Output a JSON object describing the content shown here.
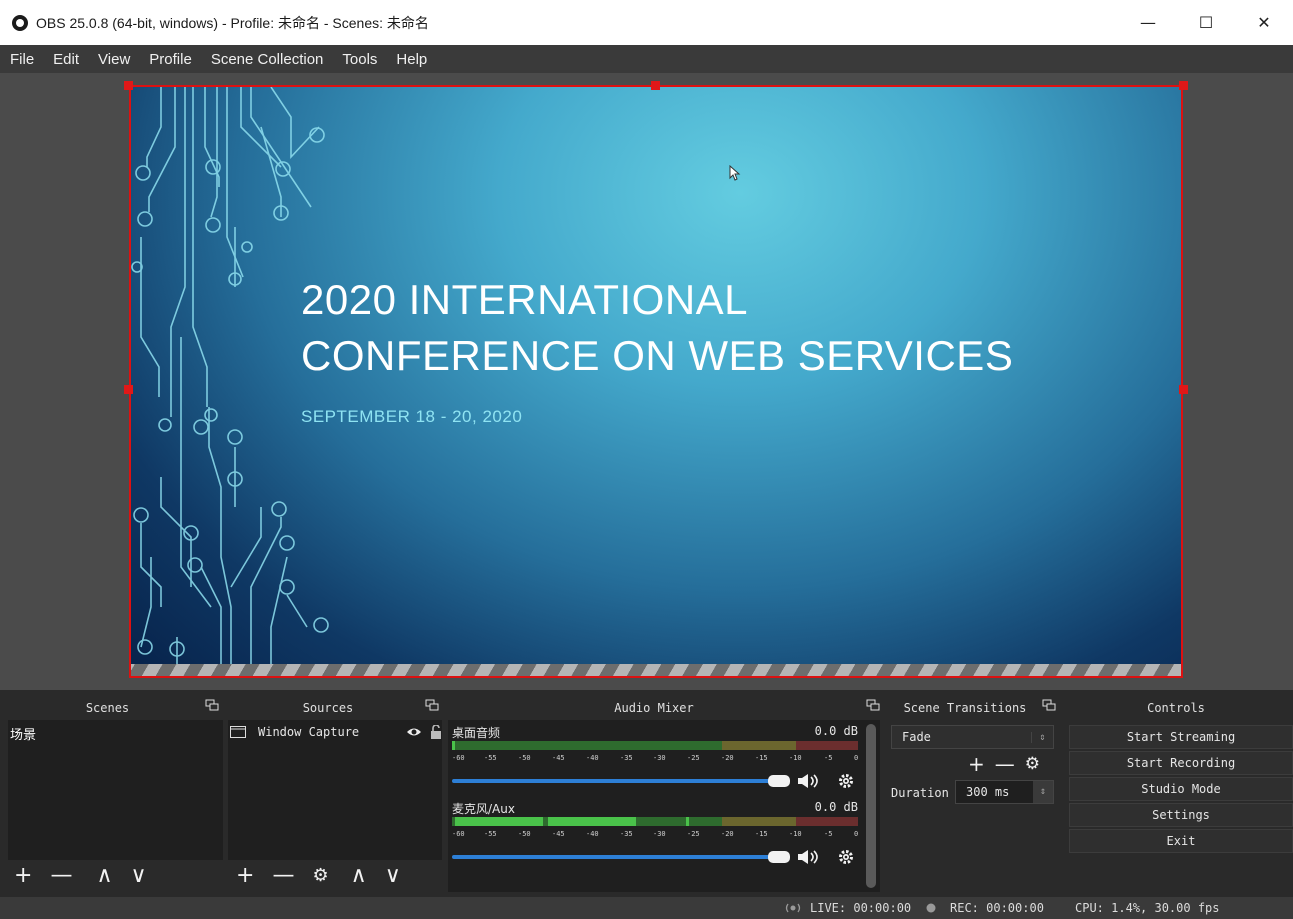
{
  "window": {
    "title": "OBS 25.0.8 (64-bit, windows) - Profile: 未命名 - Scenes: 未命名",
    "minimize": "—",
    "maximize": "☐",
    "close": "✕"
  },
  "menu": [
    "File",
    "Edit",
    "View",
    "Profile",
    "Scene Collection",
    "Tools",
    "Help"
  ],
  "slide": {
    "title_line1": "2020 INTERNATIONAL",
    "title_line2": "CONFERENCE ON WEB SERVICES",
    "date": "SEPTEMBER 18 - 20, 2020"
  },
  "docks": {
    "scenes": "Scenes",
    "sources": "Sources",
    "audio_mixer": "Audio Mixer",
    "scene_transitions": "Scene Transitions",
    "controls": "Controls"
  },
  "scenes": {
    "items": [
      "场景"
    ],
    "tools": [
      "+",
      "—",
      "∧",
      "∨"
    ]
  },
  "sources": {
    "items": [
      {
        "name": "Window Capture",
        "visible": true,
        "locked": false
      }
    ],
    "tools": [
      "+",
      "—",
      "⚙",
      "∧",
      "∨"
    ]
  },
  "audio_mixer": {
    "channels": [
      {
        "name": "桌面音频",
        "db": "0.0 dB",
        "volume_fraction": 1.0
      },
      {
        "name": "麦克风/Aux",
        "db": "0.0 dB",
        "volume_fraction": 1.0
      }
    ],
    "scale": [
      "-60",
      "-55",
      "-50",
      "-45",
      "-40",
      "-35",
      "-30",
      "-25",
      "-20",
      "-15",
      "-10",
      "-5",
      "0"
    ]
  },
  "scene_transitions": {
    "transition": "Fade",
    "duration_label": "Duration",
    "duration_value": "300 ms",
    "tools": [
      "+",
      "—",
      "⚙"
    ]
  },
  "controls": {
    "buttons": [
      "Start Streaming",
      "Start Recording",
      "Studio Mode",
      "Settings",
      "Exit"
    ]
  },
  "status": {
    "live": "LIVE: 00:00:00",
    "rec": "REC: 00:00:00",
    "cpu": "CPU: 1.4%, 30.00 fps"
  },
  "colors": {
    "selection_border": "#e01818",
    "meter_green": "#4ac24a",
    "meter_yellow": "#c2b84a",
    "meter_red": "#c24a4a",
    "volume_blue": "#2d7fd6"
  }
}
